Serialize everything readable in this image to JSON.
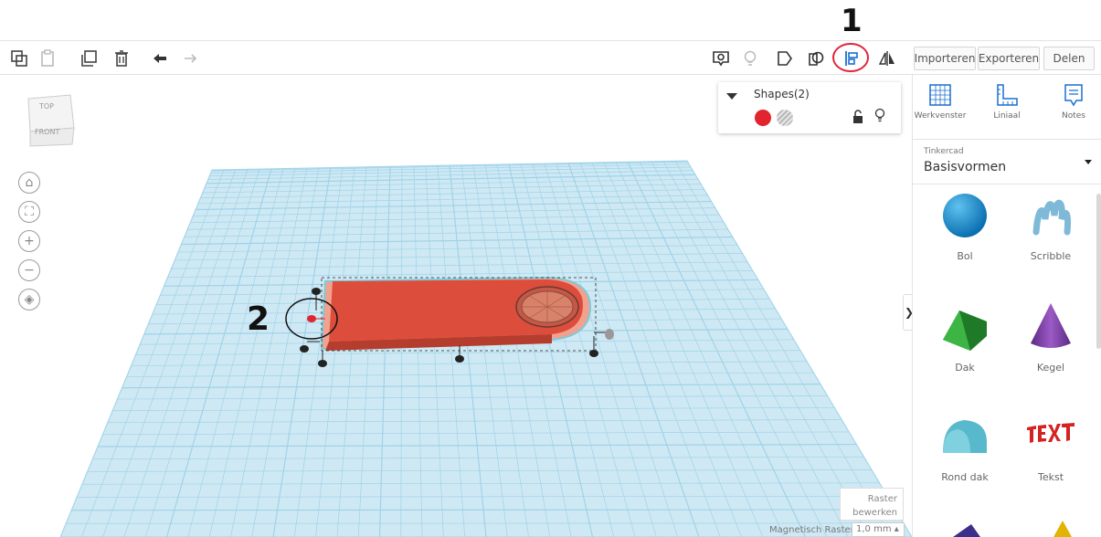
{
  "annotations": {
    "marker_1": "1",
    "marker_2": "2"
  },
  "toolbar": {
    "left_icons": [
      "copy-icon",
      "paste-icon",
      "duplicate-icon",
      "trash-icon",
      "undo-icon",
      "redo-icon"
    ],
    "right_icons": [
      "note-icon",
      "lightbulb-icon",
      "group-icon",
      "ungroup-icon",
      "align-icon",
      "mirror-icon"
    ],
    "import_label": "Importeren",
    "export_label": "Exporteren",
    "share_label": "Delen"
  },
  "viewcube": {
    "top_label": "TOP",
    "front_label": "FRONT"
  },
  "shapes_panel": {
    "title": "Shapes(2)",
    "solid_color": "#e2242e"
  },
  "right_panel": {
    "tools": [
      {
        "icon": "workplane-icon",
        "label": "Werkvenster"
      },
      {
        "icon": "ruler-icon",
        "label": "Liniaal"
      },
      {
        "icon": "notes-icon",
        "label": "Notes"
      }
    ],
    "library_source": "Tinkercad",
    "library_name": "Basisvormen",
    "shapes": [
      {
        "label": "Bol",
        "color": "#1a8fd6"
      },
      {
        "label": "Scribble",
        "color": "#7fb9d8"
      },
      {
        "label": "Dak",
        "color": "#2e9b36"
      },
      {
        "label": "Kegel",
        "color": "#7b3fa2"
      },
      {
        "label": "Rond dak",
        "color": "#58b9cc"
      },
      {
        "label": "Tekst",
        "color": "#d42323"
      }
    ]
  },
  "workspace": {
    "edit_grid_label_1": "Raster",
    "edit_grid_label_2": "bewerken",
    "snap_grid_label": "Magnetisch Raster",
    "snap_grid_value": "1,0 mm ▴"
  },
  "colors": {
    "grid": "#a8d8ec",
    "object": "#dd4d3c",
    "highlight_circle": "#e2243c"
  }
}
